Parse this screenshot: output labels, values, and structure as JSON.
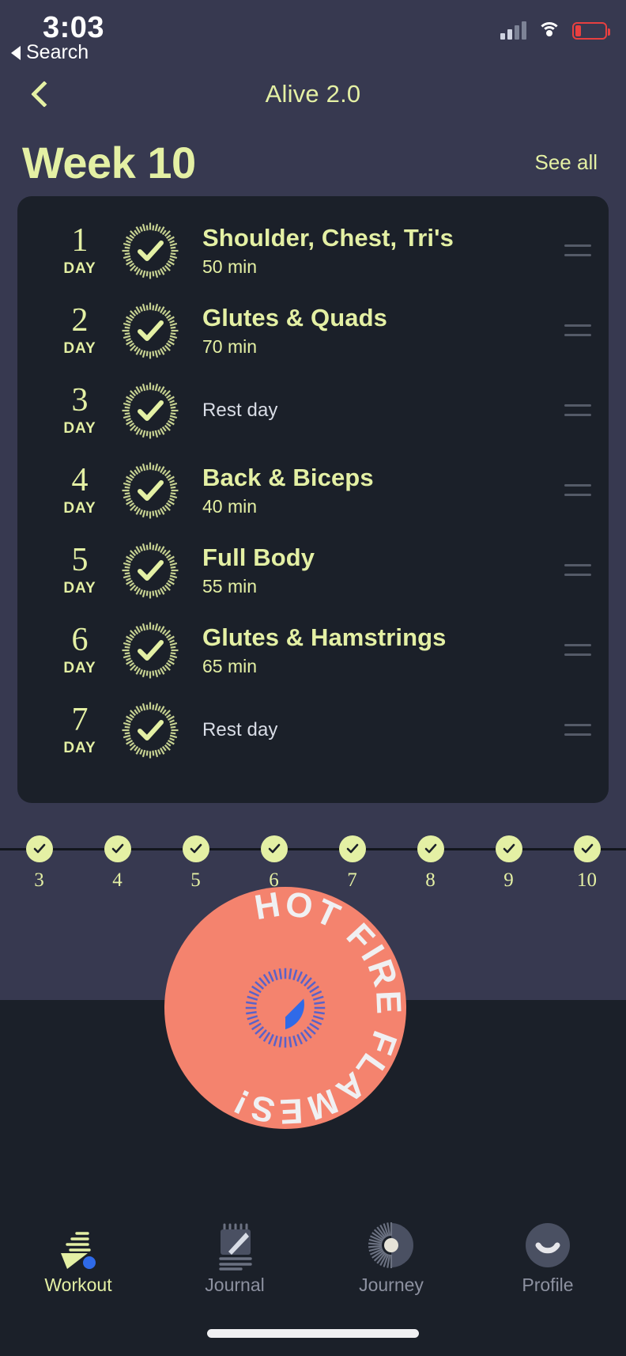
{
  "status_bar": {
    "time": "3:03",
    "back_label": "Search",
    "icons": {
      "cellular": "signal-bars-icon",
      "wifi": "wifi-icon",
      "battery": "battery-low-icon"
    }
  },
  "nav": {
    "back_icon": "chevron-left-icon",
    "title": "Alive 2.0"
  },
  "week_header": {
    "title": "Week 10",
    "see_all": "See all"
  },
  "day_label": "DAY",
  "days": [
    {
      "num": "1",
      "title": "Shoulder, Chest, Tri's",
      "duration": "50 min",
      "rest": false,
      "status": "complete"
    },
    {
      "num": "2",
      "title": "Glutes & Quads",
      "duration": "70 min",
      "rest": false,
      "status": "complete"
    },
    {
      "num": "3",
      "title": "Rest day",
      "duration": "",
      "rest": true,
      "status": "complete"
    },
    {
      "num": "4",
      "title": "Back & Biceps",
      "duration": "40 min",
      "rest": false,
      "status": "complete"
    },
    {
      "num": "5",
      "title": "Full Body",
      "duration": "55 min",
      "rest": false,
      "status": "complete"
    },
    {
      "num": "6",
      "title": "Glutes & Hamstrings",
      "duration": "65 min",
      "rest": false,
      "status": "complete"
    },
    {
      "num": "7",
      "title": "Rest day",
      "duration": "",
      "rest": true,
      "status": "complete"
    }
  ],
  "week_timeline": {
    "weeks": [
      "3",
      "4",
      "5",
      "6",
      "7",
      "8",
      "9",
      "10"
    ],
    "completed": [
      true,
      true,
      true,
      true,
      true,
      true,
      true,
      true
    ]
  },
  "badge": {
    "text": "HOT FIRE FLAMES!",
    "center_icon": "safari-compass-icon",
    "color": "#f4836e",
    "text_color": "#f0f0f2"
  },
  "tabs": [
    {
      "label": "Workout",
      "icon": "workout-bolt-icon",
      "active": true
    },
    {
      "label": "Journal",
      "icon": "notebook-pencil-icon",
      "active": false
    },
    {
      "label": "Journey",
      "icon": "journey-burst-icon",
      "active": false
    },
    {
      "label": "Profile",
      "icon": "profile-avatar-icon",
      "active": false
    }
  ],
  "colors": {
    "accent": "#e4f0a4",
    "background": "#373950",
    "card": "#1b2029",
    "badge": "#f4836e",
    "muted": "#8d91a0"
  }
}
